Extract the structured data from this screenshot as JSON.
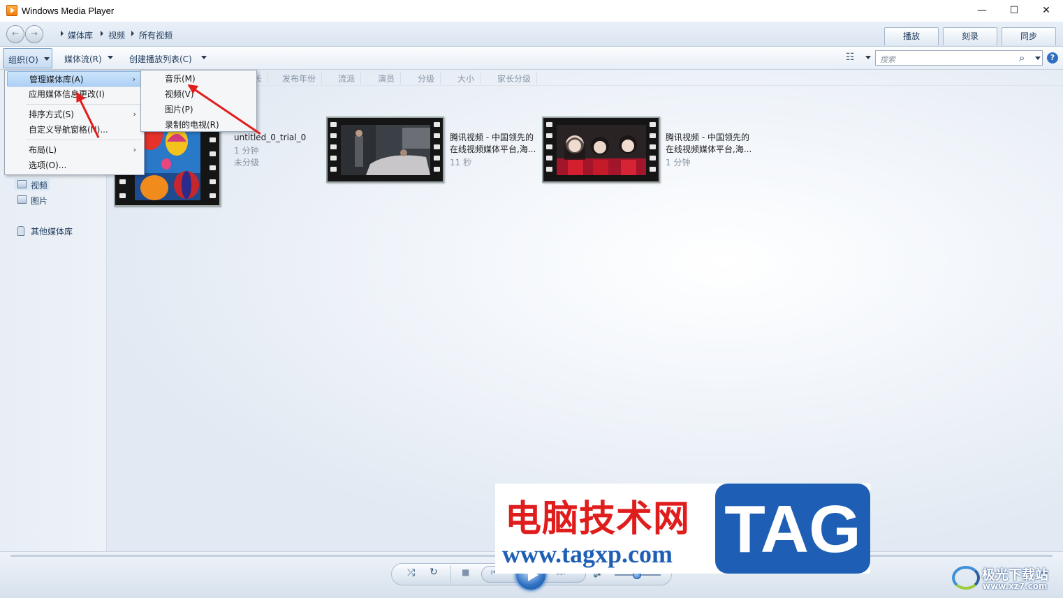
{
  "window": {
    "title": "Windows Media Player",
    "minimize": "—",
    "maximize": "☐",
    "close": "✕"
  },
  "breadcrumb": [
    "媒体库",
    "视频",
    "所有视频"
  ],
  "tabs": [
    "播放",
    "刻录",
    "同步"
  ],
  "toolbar": {
    "organize": "组织(O)",
    "stream": "媒体流(R)",
    "create_playlist": "创建播放列表(C)"
  },
  "search": {
    "placeholder": "搜索"
  },
  "columns": [
    "发布年份",
    "流派",
    "演员",
    "分级",
    "大小",
    "家长分级"
  ],
  "column_partial": "长",
  "sidebar": {
    "videos": "视频",
    "pictures": "图片",
    "other_libraries": "其他媒体库"
  },
  "videos": [
    {
      "title": "untitled_0_trial_0",
      "title2": "",
      "duration": "1 分钟",
      "rating": "未分级"
    },
    {
      "title": "腾讯视频 - 中国领先的",
      "title2": "在线视频媒体平台,海...",
      "duration": "11 秒",
      "rating": ""
    },
    {
      "title": "腾讯视频 - 中国领先的",
      "title2": "在线视频媒体平台,海...",
      "duration": "1 分钟",
      "rating": ""
    }
  ],
  "menu": [
    {
      "label": "管理媒体库(A)",
      "has_sub": "›"
    },
    {
      "label": "应用媒体信息更改(I)"
    },
    {
      "label": "排序方式(S)",
      "has_sub": "›"
    },
    {
      "label": "自定义导航窗格(N)..."
    },
    {
      "label": "布局(L)",
      "has_sub": "›"
    },
    {
      "label": "选项(O)..."
    }
  ],
  "submenu": [
    "音乐(M)",
    "视频(V)",
    "图片(P)",
    "录制的电视(R)"
  ],
  "icons": {
    "back": "back-arrow-icon",
    "forward": "forward-arrow-icon",
    "search": "magnifier-icon",
    "help": "help-icon",
    "view": "view-options-icon",
    "shuffle": "shuffle-icon",
    "repeat": "repeat-icon",
    "stop": "stop-icon",
    "prev": "previous-icon",
    "play": "play-icon",
    "next": "next-icon",
    "volume": "volume-icon"
  },
  "glyphs": {
    "back": "←",
    "forward": "→",
    "search": "⌕",
    "help": "?",
    "view": "☷",
    "shuffle": "⤮",
    "repeat": "↻",
    "stop": "■",
    "prev": "⏮",
    "next": "⏭",
    "volume": "🔊",
    "fullscreen": "⧉"
  },
  "watermark": {
    "cn": "电脑技术网",
    "tag": "TAG",
    "url": "www.tagxp.com"
  },
  "watermark2": {
    "cn": "极光下载站",
    "url": "www.xz7.com"
  },
  "colors": {
    "accent": "#1e5fb5",
    "highlight": "#aed1f6",
    "annotation": "#e31c1c"
  }
}
